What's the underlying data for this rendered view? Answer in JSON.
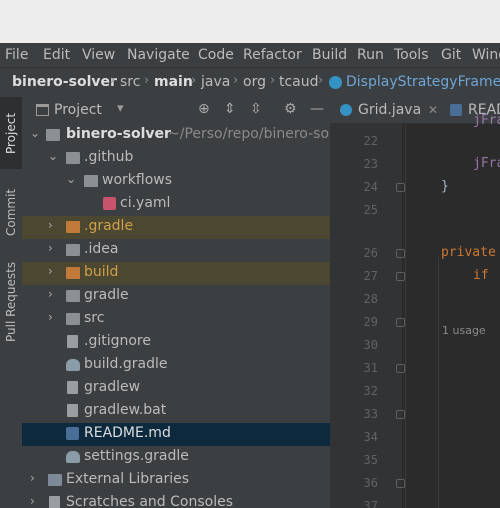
{
  "menu": [
    "File",
    "Edit",
    "View",
    "Navigate",
    "Code",
    "Refactor",
    "Build",
    "Run",
    "Tools",
    "Git",
    "Wind"
  ],
  "breadcrumb": [
    "binero-solver",
    "src",
    "main",
    "java",
    "org",
    "tcaud",
    "DisplayStrategyFrame"
  ],
  "left_tabs": {
    "project": "Project",
    "commit": "Commit",
    "pull_requests": "Pull Requests"
  },
  "panel": {
    "title": "Project"
  },
  "tree": [
    {
      "label": "binero-solver",
      "extra": "~/Perso/repo/binero-sol"
    },
    {
      "label": ".github"
    },
    {
      "label": "workflows"
    },
    {
      "label": "ci.yaml"
    },
    {
      "label": ".gradle"
    },
    {
      "label": ".idea"
    },
    {
      "label": "build"
    },
    {
      "label": "gradle"
    },
    {
      "label": "src"
    },
    {
      "label": ".gitignore"
    },
    {
      "label": "build.gradle"
    },
    {
      "label": "gradlew"
    },
    {
      "label": "gradlew.bat"
    },
    {
      "label": "README.md"
    },
    {
      "label": "settings.gradle"
    },
    {
      "label": "External Libraries"
    },
    {
      "label": "Scratches and Consoles"
    }
  ],
  "editor_tabs": [
    {
      "label": "Grid.java"
    },
    {
      "label": "READ"
    }
  ],
  "line_numbers": [
    "22",
    "23",
    "24",
    "25",
    "26",
    "27",
    "28",
    "29",
    "30",
    "31",
    "32",
    "33",
    "34",
    "35",
    "36",
    "37"
  ],
  "code": {
    "l21_partial": "jFra",
    "l23": "jFra",
    "l24": "}",
    "hint": "1 usage",
    "l26_kw": "private",
    "l27_kw": "if"
  }
}
